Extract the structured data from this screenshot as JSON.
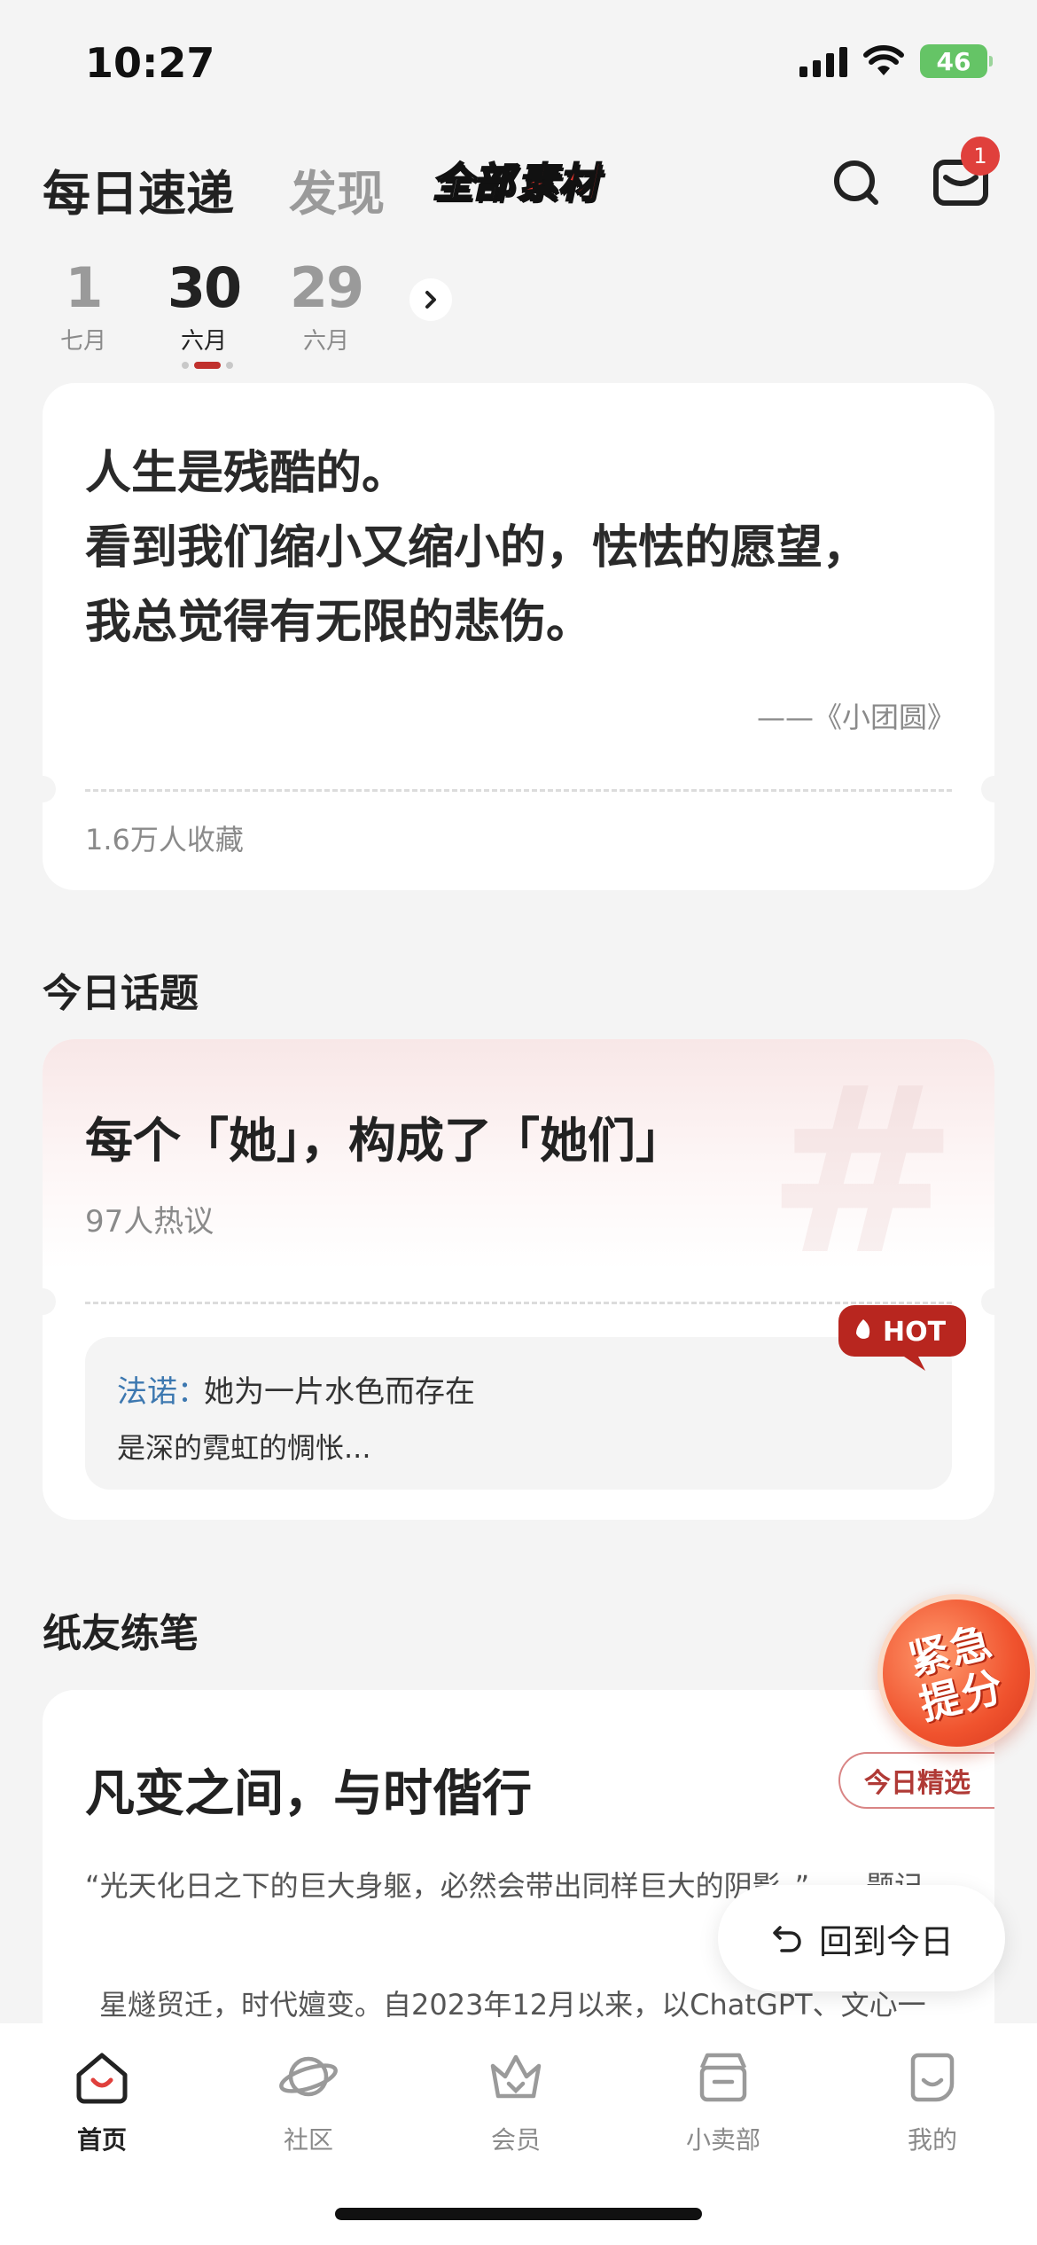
{
  "status_bar": {
    "time": "10:27",
    "battery": "46"
  },
  "header": {
    "tabs": [
      {
        "label": "每日速递",
        "active": true
      },
      {
        "label": "发现",
        "active": false
      }
    ],
    "materials_logo": {
      "part1": "全部",
      "part2": "素材"
    },
    "inbox_badge": "1"
  },
  "dates": [
    {
      "day": "1",
      "month": "七月",
      "selected": false
    },
    {
      "day": "30",
      "month": "六月",
      "selected": true
    },
    {
      "day": "29",
      "month": "六月",
      "selected": false
    }
  ],
  "quote_card": {
    "lines": [
      "人生是残酷的。",
      "看到我们缩小又缩小的，怯怯的愿望，",
      "我总觉得有无限的悲伤。"
    ],
    "source": "——《小团圆》",
    "saves": "1.6万人收藏"
  },
  "topic_section": {
    "heading": "今日话题",
    "title": "每个「她」，构成了「她们」",
    "discussions": "97人热议",
    "hot_label": "HOT",
    "comment": {
      "author": "法诺：",
      "line1": "她为一片水色而存在",
      "line2": "是深的霓虹的惆怅..."
    }
  },
  "practice_section": {
    "heading": "纸友练笔",
    "title": "凡变之间，与时偕行",
    "tag": "今日精选",
    "epigraph": "“光天化日之下的巨大身躯，必然会带出同样巨大的阴影。”——题记",
    "excerpt": "星燧贸迁，时代嬗变。自2023年12月以来，以ChatGPT、文心一"
  },
  "floating": {
    "boost_line1": "紧急",
    "boost_line2": "提分",
    "back_today": "回到今日"
  },
  "tab_bar": [
    {
      "label": "首页",
      "icon": "home-icon",
      "active": true
    },
    {
      "label": "社区",
      "icon": "planet-icon",
      "active": false
    },
    {
      "label": "会员",
      "icon": "crown-icon",
      "active": false
    },
    {
      "label": "小卖部",
      "icon": "shop-icon",
      "active": false
    },
    {
      "label": "我的",
      "icon": "profile-icon",
      "active": false
    }
  ],
  "colors": {
    "accent": "#c0302c",
    "background": "#f4f4f4",
    "link_blue": "#3d78b0",
    "battery_green": "#65c466"
  }
}
